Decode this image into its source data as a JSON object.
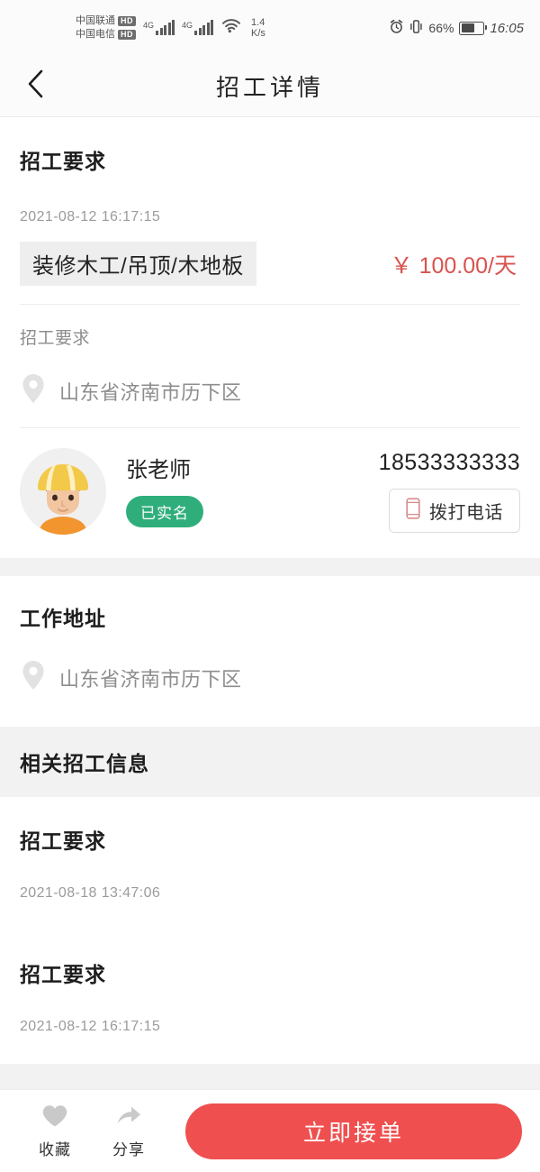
{
  "status_bar": {
    "carrier_1": "中国联通",
    "carrier_1_badge": "HD",
    "carrier_2": "中国电信",
    "carrier_2_badge": "HD",
    "network_1": "4G",
    "network_2": "4G",
    "speed_value": "1.4",
    "speed_unit": "K/s",
    "battery_percent": "66%",
    "battery_level": 66,
    "time": "16:05"
  },
  "header": {
    "title": "招工详情",
    "back_icon": "chevron-left-icon"
  },
  "job": {
    "section_title": "招工要求",
    "posted_time": "2021-08-12 16:17:15",
    "tag": "装修木工/吊顶/木地板",
    "price": "￥ 100.00/天",
    "price_color": "#d9534f",
    "description": "招工要求",
    "location_icon": "location-pin-icon",
    "location": "山东省济南市历下区"
  },
  "contact": {
    "avatar_icon": "worker-avatar",
    "name": "张老师",
    "verified_label": "已实名",
    "verified_color": "#2fae7b",
    "phone": "18533333333",
    "call_button_label": "拨打电话",
    "call_button_icon": "mobile-phone-icon"
  },
  "work_address": {
    "section_title": "工作地址",
    "location_icon": "location-pin-icon",
    "address": "山东省济南市历下区"
  },
  "related": {
    "section_title": "相关招工信息",
    "items": [
      {
        "title": "招工要求",
        "time": "2021-08-18 13:47:06"
      },
      {
        "title": "招工要求",
        "time": "2021-08-12 16:17:15"
      }
    ]
  },
  "bottom_bar": {
    "favorite_label": "收藏",
    "favorite_icon": "heart-icon",
    "share_label": "分享",
    "share_icon": "share-arrow-icon",
    "accept_label": "立即接单",
    "accept_color": "#ef4f4f"
  }
}
